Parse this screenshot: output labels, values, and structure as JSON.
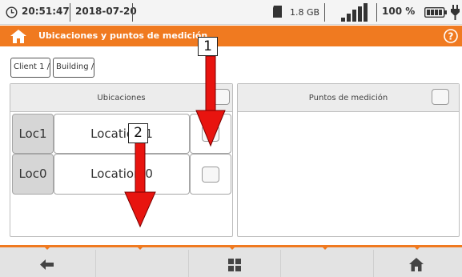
{
  "status": {
    "time": "20:51:47",
    "date": "2018-07-20",
    "storage": "1.8 GB",
    "battery": "100 %"
  },
  "title": "Ubicaciones y puntos de medición",
  "breadcrumb": [
    "Client 1 /",
    "Building /"
  ],
  "locations_panel": {
    "header": "Ubicaciones",
    "rows": [
      {
        "short": "Loc1",
        "name": "Location 1"
      },
      {
        "short": "Loc0",
        "name": "Location 0"
      }
    ]
  },
  "points_panel": {
    "header": "Puntos de medición"
  },
  "callouts": [
    "1",
    "2"
  ],
  "colors": {
    "accent": "#f07a20",
    "arrow": "#e8140f"
  },
  "icons": [
    "clock-icon",
    "sd-card-icon",
    "signal-icon",
    "battery-icon",
    "plug-icon",
    "home-icon",
    "help-icon",
    "back-arrow-icon",
    "grid-icon",
    "home-icon"
  ]
}
